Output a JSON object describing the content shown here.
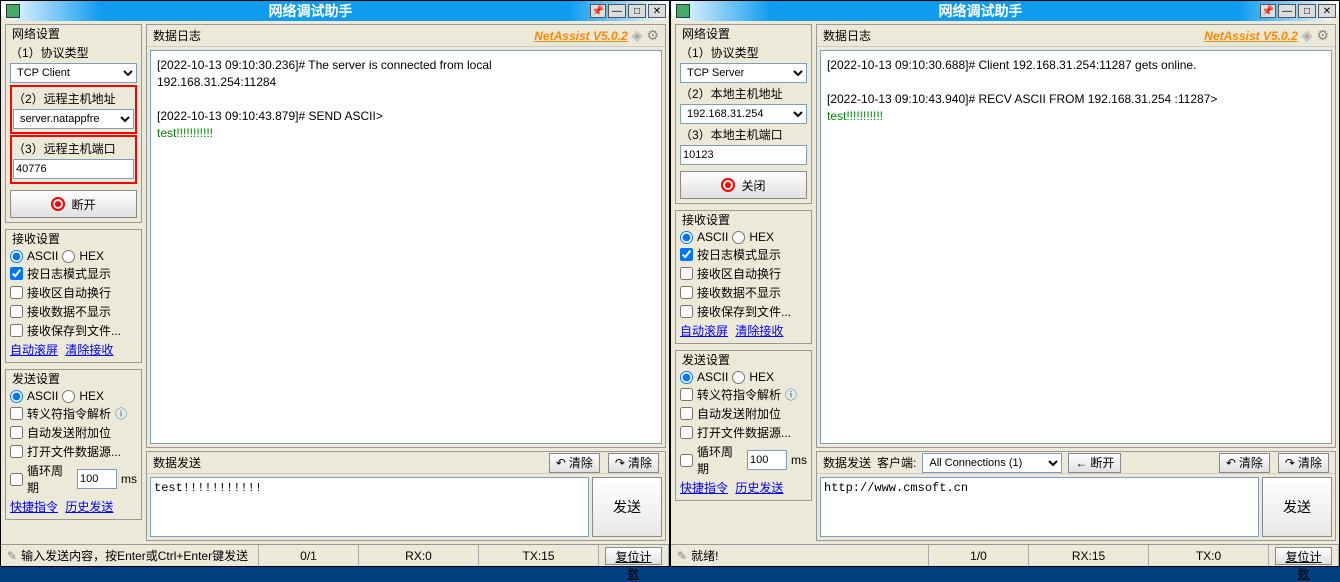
{
  "app_title": "网络调试助手",
  "brand": "NetAssist V5.0.2",
  "left": {
    "net_settings": "网络设置",
    "proto_label": "（1）协议类型",
    "proto_value": "TCP Client",
    "remote_host_label": "（2）远程主机地址",
    "remote_host_value": "server.natappfre",
    "remote_port_label": "（3）远程主机端口",
    "remote_port_value": "40776",
    "action_btn": "断开",
    "recv_title": "接收设置",
    "recv_ascii": "ASCII",
    "recv_hex": "HEX",
    "recv_logmode": "按日志模式显示",
    "recv_wrap": "接收区自动换行",
    "recv_hide": "接收数据不显示",
    "recv_savefile": "接收保存到文件...",
    "link_autoscroll": "自动滚屏",
    "link_clearrecv": "清除接收",
    "send_title": "发送设置",
    "send_ascii": "ASCII",
    "send_hex": "HEX",
    "send_escape": "转义符指令解析",
    "send_autoextra": "自动发送附加位",
    "send_openfile": "打开文件数据源...",
    "send_loop": "循环周期",
    "send_loop_val": "100",
    "send_loop_unit": "ms",
    "link_quick": "快捷指令",
    "link_history": "历史发送",
    "log_title": "数据日志",
    "log_lines": "[2022-10-13 09:10:30.236]# The server is connected from local\n192.168.31.254:11284\n\n[2022-10-13 09:10:43.879]# SEND ASCII>\n",
    "log_green": "test!!!!!!!!!!!",
    "send_panel_title": "数据发送",
    "clear_up": "清除",
    "clear_down": "清除",
    "send_input": "test!!!!!!!!!!!",
    "send_btn": "发送",
    "status_hint": "输入发送内容，按Enter或Ctrl+Enter键发送",
    "status_count": "0/1",
    "status_rx": "RX:0",
    "status_tx": "TX:15",
    "status_reset": "复位计数"
  },
  "right": {
    "proto_value": "TCP Server",
    "local_host_label": "（2）本地主机地址",
    "local_host_value": "192.168.31.254",
    "local_port_label": "（3）本地主机端口",
    "local_port_value": "10123",
    "action_btn": "关闭",
    "log_lines": "[2022-10-13 09:10:30.688]# Client 192.168.31.254:11287 gets online.\n\n[2022-10-13 09:10:43.940]# RECV ASCII FROM 192.168.31.254 :11287>\n",
    "log_green": "test!!!!!!!!!!!",
    "send_client_label": "客户端:",
    "send_client_value": "All Connections (1)",
    "send_disconnect": "断开",
    "send_input": "http://www.cmsoft.cn",
    "status_hint": "就绪!",
    "status_count": "1/0",
    "status_rx": "RX:15",
    "status_tx": "TX:0"
  }
}
